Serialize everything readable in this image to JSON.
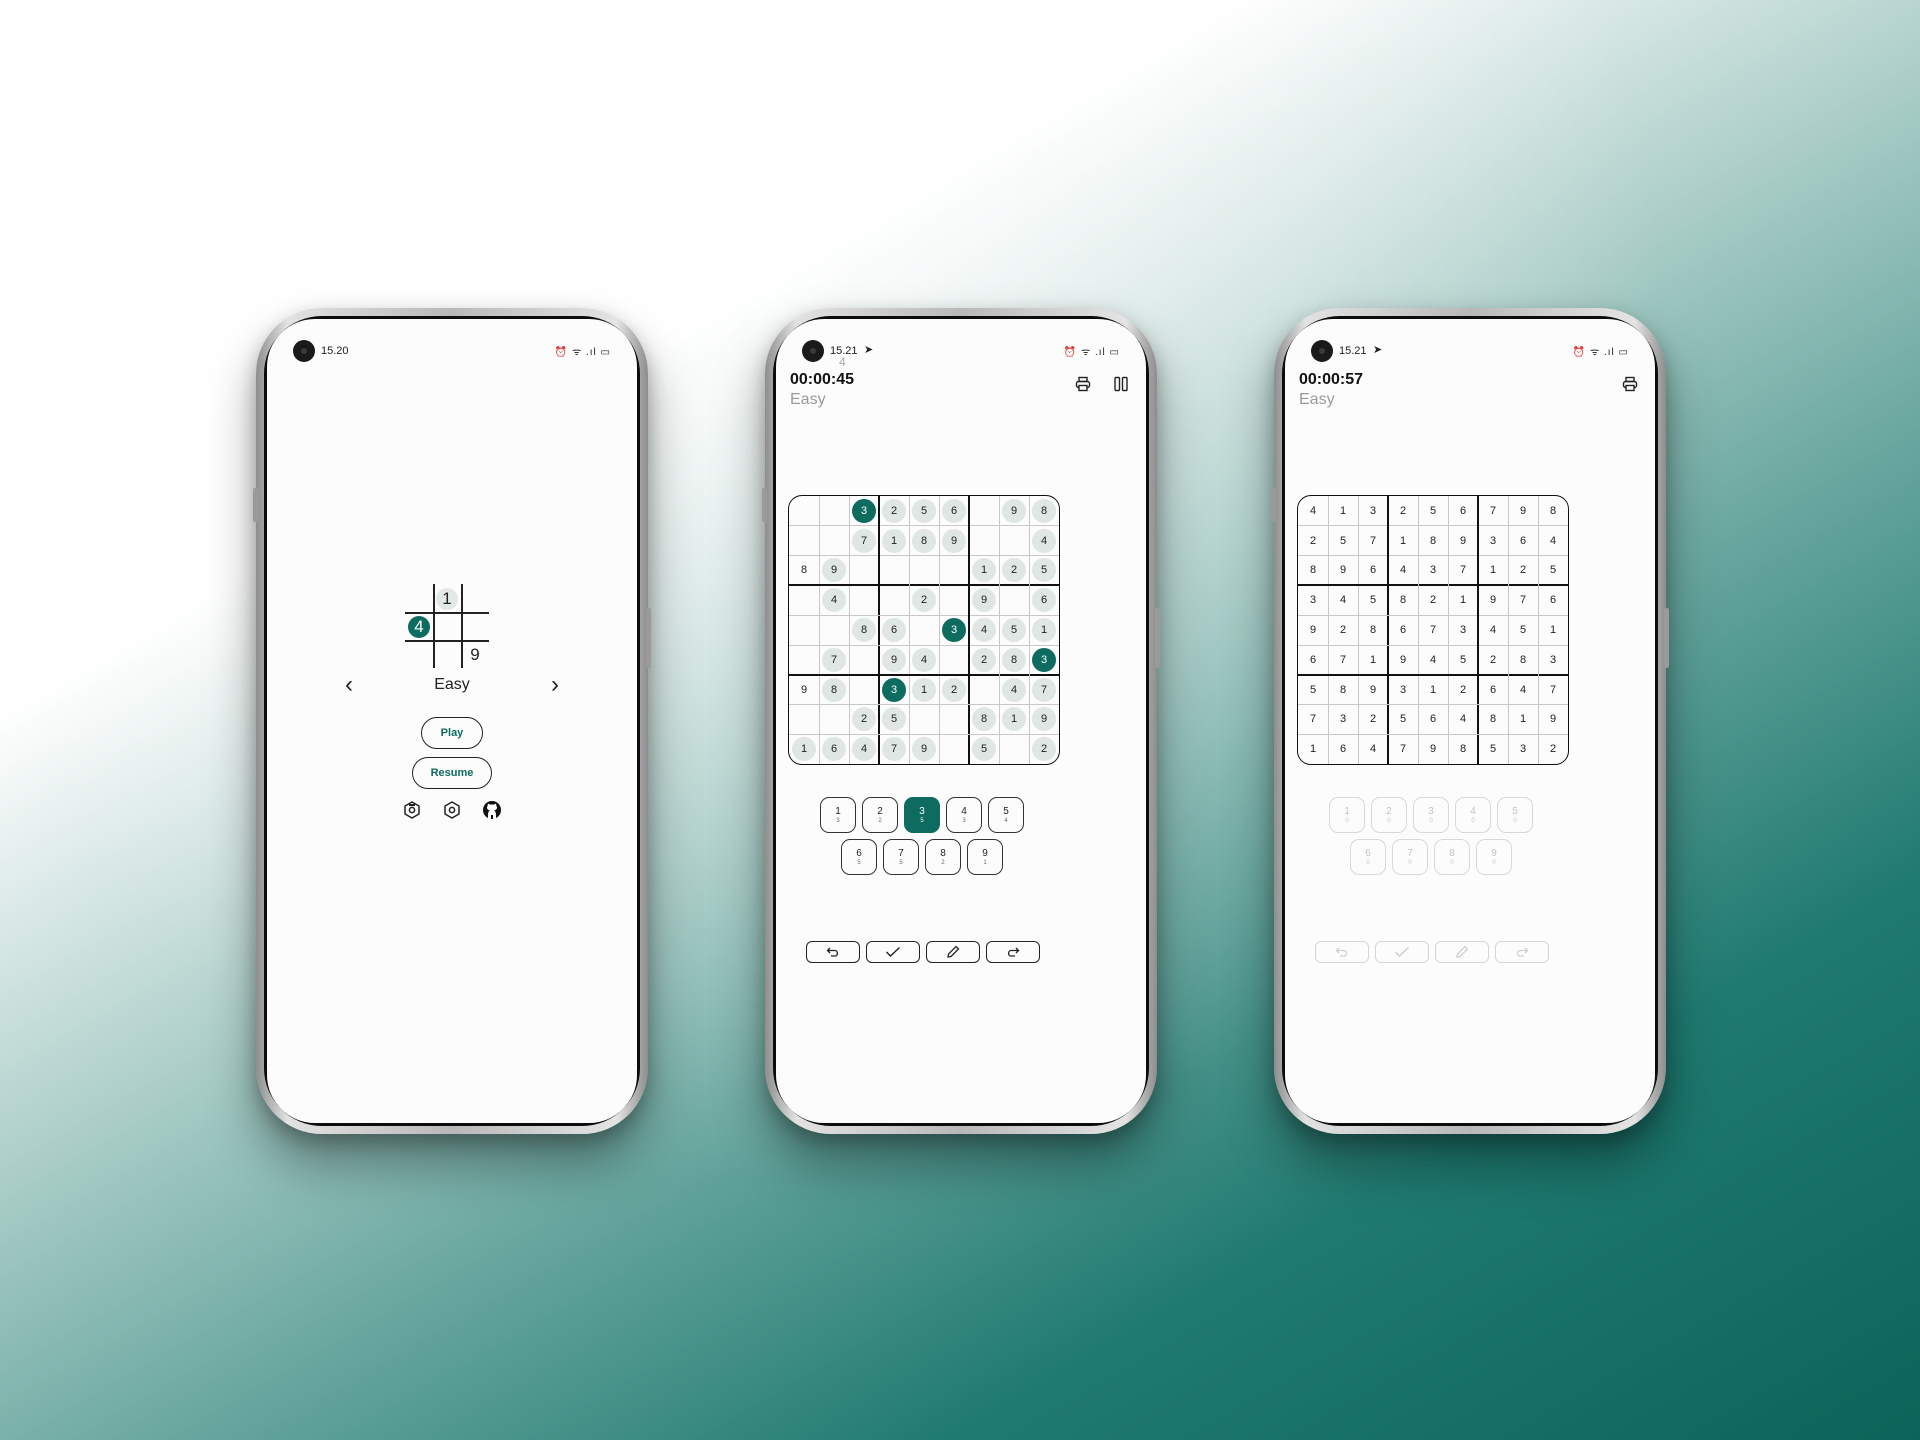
{
  "phones": [
    {
      "status_time": "15.20",
      "difficulty": "Easy",
      "play_label": "Play",
      "resume_label": "Resume",
      "logo_digits": [
        "1",
        "4",
        "9"
      ],
      "icons": [
        "settings-icon",
        "theme-icon",
        "github-icon"
      ]
    },
    {
      "status_time": "15.21",
      "timer": "00:00:45",
      "timer_ghost": "4",
      "level": "Easy",
      "top_icons": [
        "print-icon",
        "pause-icon"
      ],
      "board": [
        [
          "",
          "",
          "3",
          "2",
          "5",
          "6",
          "",
          "9",
          "8"
        ],
        [
          "",
          "",
          "7",
          "1",
          "8",
          "9",
          "",
          "",
          "4"
        ],
        [
          "8",
          "9",
          "",
          "",
          "",
          "",
          "1",
          "2",
          "5"
        ],
        [
          "",
          "4",
          "",
          "",
          "2",
          "",
          "9",
          "",
          "6"
        ],
        [
          "",
          "",
          "8",
          "6",
          "",
          "3",
          "4",
          "5",
          "1"
        ],
        [
          "",
          "7",
          "",
          "9",
          "4",
          "",
          "2",
          "8",
          "3"
        ],
        [
          "9",
          "8",
          "",
          "3",
          "1",
          "2",
          "",
          "4",
          "7"
        ],
        [
          "",
          "",
          "2",
          "5",
          "",
          "",
          "8",
          "1",
          "9"
        ],
        [
          "1",
          "6",
          "4",
          "7",
          "9",
          "",
          "5",
          "",
          "2"
        ]
      ],
      "given": [
        [
          0,
          0,
          0,
          0,
          0,
          0,
          0,
          0,
          0
        ],
        [
          0,
          0,
          0,
          0,
          0,
          0,
          0,
          0,
          0
        ],
        [
          1,
          0,
          0,
          0,
          0,
          0,
          0,
          0,
          0
        ],
        [
          0,
          0,
          0,
          0,
          0,
          0,
          0,
          0,
          0
        ],
        [
          0,
          0,
          0,
          0,
          0,
          0,
          0,
          0,
          0
        ],
        [
          0,
          0,
          0,
          0,
          0,
          0,
          0,
          0,
          0
        ],
        [
          1,
          0,
          0,
          0,
          0,
          0,
          0,
          0,
          0
        ],
        [
          0,
          0,
          0,
          0,
          0,
          0,
          0,
          0,
          0
        ],
        [
          0,
          0,
          0,
          0,
          0,
          0,
          0,
          0,
          0
        ]
      ],
      "numpad": [
        {
          "n": "1",
          "c": "3"
        },
        {
          "n": "2",
          "c": "2"
        },
        {
          "n": "3",
          "c": "5"
        },
        {
          "n": "4",
          "c": "3"
        },
        {
          "n": "5",
          "c": "4"
        },
        {
          "n": "6",
          "c": "5"
        },
        {
          "n": "7",
          "c": "5"
        },
        {
          "n": "8",
          "c": "2"
        },
        {
          "n": "9",
          "c": "1"
        }
      ],
      "selected_number": "3",
      "toolbar": [
        "undo-icon",
        "check-icon",
        "pencil-icon",
        "redo-icon"
      ]
    },
    {
      "status_time": "15.21",
      "timer": "00:00:57",
      "level": "Easy",
      "top_icons": [
        "print-icon"
      ],
      "board": [
        [
          "4",
          "1",
          "3",
          "2",
          "5",
          "6",
          "7",
          "9",
          "8"
        ],
        [
          "2",
          "5",
          "7",
          "1",
          "8",
          "9",
          "3",
          "6",
          "4"
        ],
        [
          "8",
          "9",
          "6",
          "4",
          "3",
          "7",
          "1",
          "2",
          "5"
        ],
        [
          "3",
          "4",
          "5",
          "8",
          "2",
          "1",
          "9",
          "7",
          "6"
        ],
        [
          "9",
          "2",
          "8",
          "6",
          "7",
          "3",
          "4",
          "5",
          "1"
        ],
        [
          "6",
          "7",
          "1",
          "9",
          "4",
          "5",
          "2",
          "8",
          "3"
        ],
        [
          "5",
          "8",
          "9",
          "3",
          "1",
          "2",
          "6",
          "4",
          "7"
        ],
        [
          "7",
          "3",
          "2",
          "5",
          "6",
          "4",
          "8",
          "1",
          "9"
        ],
        [
          "1",
          "6",
          "4",
          "7",
          "9",
          "8",
          "5",
          "3",
          "2"
        ]
      ],
      "numpad": [
        {
          "n": "1",
          "c": "0"
        },
        {
          "n": "2",
          "c": "0"
        },
        {
          "n": "3",
          "c": "0"
        },
        {
          "n": "4",
          "c": "0"
        },
        {
          "n": "5",
          "c": "0"
        },
        {
          "n": "6",
          "c": "0"
        },
        {
          "n": "7",
          "c": "0"
        },
        {
          "n": "8",
          "c": "0"
        },
        {
          "n": "9",
          "c": "0"
        }
      ],
      "toolbar": [
        "undo-icon",
        "check-icon",
        "pencil-icon",
        "redo-icon"
      ]
    }
  ],
  "colors": {
    "accent": "#0d6b5f",
    "filled_cell": "#dfe6e3"
  }
}
